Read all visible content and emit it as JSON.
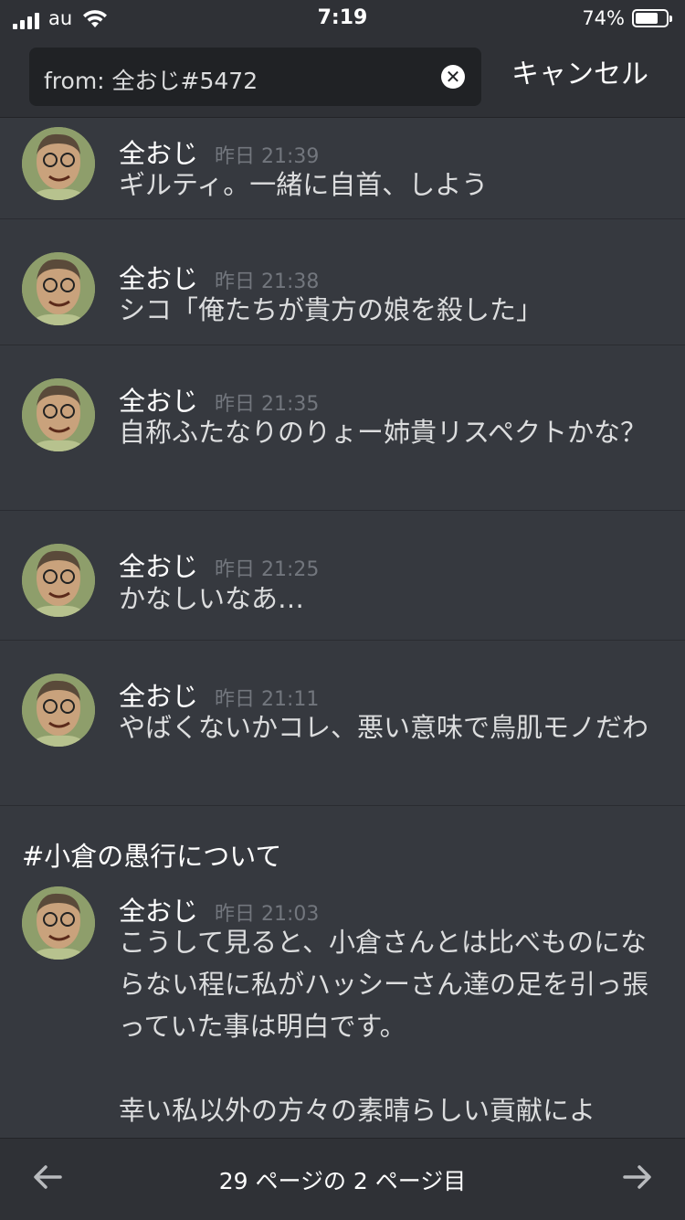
{
  "status_bar": {
    "carrier": "au",
    "time": "7:19",
    "battery_percent": "74%",
    "battery_level": 0.74
  },
  "search": {
    "query": "from: 全おじ#5472",
    "cancel_label": "キャンセル",
    "clear_icon": "close-circle-icon"
  },
  "results": [
    {
      "author": "全おじ",
      "timestamp": "昨日 21:39",
      "body": "ギルティ。一緒に自首、しよう"
    },
    {
      "author": "全おじ",
      "timestamp": "昨日 21:38",
      "body": "シコ「俺たちが貴方の娘を殺した」"
    },
    {
      "author": "全おじ",
      "timestamp": "昨日 21:35",
      "body": "自称ふたなりのりょー姉貴リスペクトかな？"
    },
    {
      "author": "全おじ",
      "timestamp": "昨日 21:25",
      "body": "かなしいなあ…"
    },
    {
      "author": "全おじ",
      "timestamp": "昨日 21:11",
      "body": "やばくないかコレ、悪い意味で鳥肌モノだわ"
    },
    {
      "channel": "#小倉の愚行について",
      "author": "全おじ",
      "timestamp": "昨日 21:03",
      "body": "こうして見ると、小倉さんとは比べものにならない程に私がハッシーさん達の足を引っ張っていた事は明白です。\n\n幸い私以外の方々の素晴らしい貢献によ"
    }
  ],
  "pagination": {
    "label": "29 ページの 2 ページ目",
    "prev_icon": "arrow-left-icon",
    "next_icon": "arrow-right-icon"
  },
  "colors": {
    "background": "#36393f",
    "header": "#2f3136",
    "search_box": "#202225",
    "timestamp": "#72767d"
  }
}
